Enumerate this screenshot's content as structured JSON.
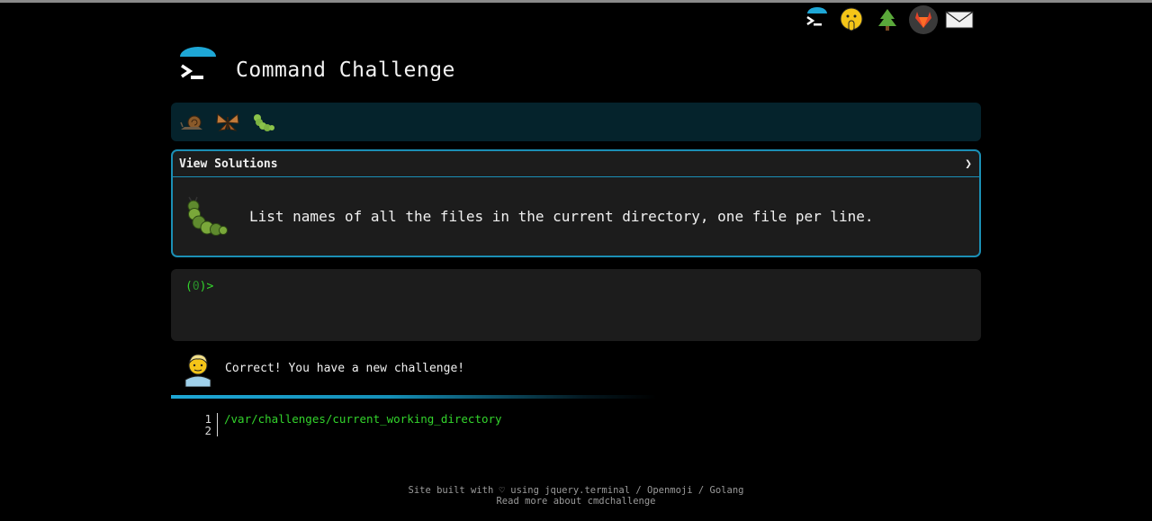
{
  "header": {
    "title": "Command Challenge"
  },
  "topbar": {
    "icons": [
      "terminal-logo-icon",
      "shushing-face-icon",
      "tree-icon",
      "gitlab-icon",
      "mail-icon"
    ]
  },
  "badges": [
    "snail-icon",
    "butterfly-icon",
    "caterpillar-icon"
  ],
  "challenge": {
    "view_solutions_label": "View Solutions",
    "chevron": "❯",
    "description": "List names of all the files in the current directory, one file per line."
  },
  "terminal": {
    "prompt_open": "(",
    "prompt_code": "0",
    "prompt_close": ")>"
  },
  "message": {
    "text": "Correct! You have a new challenge!"
  },
  "editor": {
    "lines": [
      {
        "num": "1",
        "text": "/var/challenges/current_working_directory"
      },
      {
        "num": "2",
        "text": ""
      }
    ]
  },
  "footer": {
    "line1": "Site built with ♡ using jquery.terminal / Openmoji / Golang",
    "line2": "Read more about cmdchallenge"
  },
  "colors": {
    "accent": "#1b8fb5",
    "terminal_green": "#33d42c",
    "panel_bg": "#1c1c1c",
    "badgebar_bg": "#05232c"
  }
}
